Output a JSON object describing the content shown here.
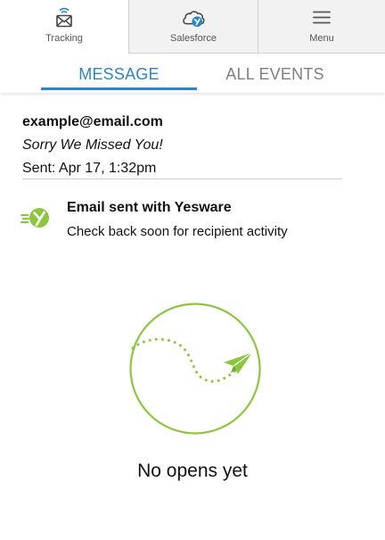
{
  "nav": {
    "tracking_label": "Tracking",
    "salesforce_label": "Salesforce",
    "menu_label": "Menu"
  },
  "tabs": {
    "message_label": "MESSAGE",
    "events_label": "ALL EVENTS"
  },
  "message": {
    "email": "example@email.com",
    "subject": "Sorry We Missed You!",
    "sent": "Sent: Apr 17, 1:32pm"
  },
  "status": {
    "title": "Email sent with Yesware",
    "subtitle": "Check back soon for recipient activity",
    "icon": "yesware-icon"
  },
  "empty_state": {
    "text": "No opens yet",
    "icon": "paper-plane-icon"
  },
  "colors": {
    "accent_blue": "#2b86c5",
    "brand_green": "#8cc63f",
    "nav_bg": "#f2f2f2",
    "tab_inactive": "#808080"
  }
}
